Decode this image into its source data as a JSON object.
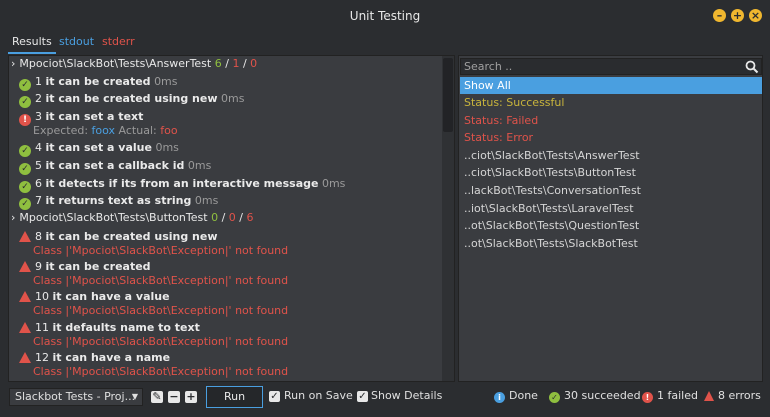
{
  "window": {
    "title": "Unit Testing"
  },
  "tabs": [
    {
      "label": "Results"
    },
    {
      "label": "stdout"
    },
    {
      "label": "stderr"
    }
  ],
  "suites": [
    {
      "name": "Mpociot\\SlackBot\\Tests\\AnswerTest",
      "passed": "6",
      "failed": "1",
      "errors": "0",
      "tests": [
        {
          "num": "1",
          "name": "it can be created",
          "time": "0ms",
          "status": "ok"
        },
        {
          "num": "2",
          "name": "it can be created using new",
          "time": "0ms",
          "status": "ok"
        },
        {
          "num": "3",
          "name": "it can set a text",
          "status": "fail",
          "expected_label": "Expected:",
          "expected": "foox",
          "actual_label": "Actual:",
          "actual": "foo"
        },
        {
          "num": "4",
          "name": "it can set a value",
          "time": "0ms",
          "status": "ok"
        },
        {
          "num": "5",
          "name": "it can set a callback id",
          "time": "0ms",
          "status": "ok"
        },
        {
          "num": "6",
          "name": "it detects if its from an interactive message",
          "time": "0ms",
          "status": "ok"
        },
        {
          "num": "7",
          "name": "it returns text as string",
          "time": "0ms",
          "status": "ok"
        }
      ]
    },
    {
      "name": "Mpociot\\SlackBot\\Tests\\ButtonTest",
      "passed": "0",
      "failed": "0",
      "errors": "6",
      "tests": [
        {
          "num": "8",
          "name": "it can be created using new",
          "status": "error",
          "message": "Class |'Mpociot\\SlackBot\\Exception|' not found"
        },
        {
          "num": "9",
          "name": "it can be created",
          "status": "error",
          "message": "Class |'Mpociot\\SlackBot\\Exception|' not found"
        },
        {
          "num": "10",
          "name": "it can have a value",
          "status": "error",
          "message": "Class |'Mpociot\\SlackBot\\Exception|' not found"
        },
        {
          "num": "11",
          "name": "it defaults name to text",
          "status": "error",
          "message": "Class |'Mpociot\\SlackBot\\Exception|' not found"
        },
        {
          "num": "12",
          "name": "it can have a name",
          "status": "error",
          "message": "Class |'Mpociot\\SlackBot\\Exception|' not found"
        }
      ]
    }
  ],
  "filter_panel": {
    "search_placeholder": "Search ..",
    "items": [
      {
        "label": "Show All",
        "selected": true
      },
      {
        "label": "Status: Successful",
        "color": "#c8b43c"
      },
      {
        "label": "Status: Failed",
        "color": "#e0534a"
      },
      {
        "label": "Status: Error",
        "color": "#e0534a"
      },
      {
        "label": "..ciot\\SlackBot\\Tests\\AnswerTest"
      },
      {
        "label": "..ciot\\SlackBot\\Tests\\ButtonTest"
      },
      {
        "label": "..lackBot\\Tests\\ConversationTest"
      },
      {
        "label": "..iot\\SlackBot\\Tests\\LaravelTest"
      },
      {
        "label": "..ot\\SlackBot\\Tests\\QuestionTest"
      },
      {
        "label": "..ot\\SlackBot\\Tests\\SlackBotTest"
      }
    ]
  },
  "toolbar": {
    "project": "Slackbot Tests - Proj...",
    "run_label": "Run",
    "run_on_save_label": "Run on Save",
    "show_details_label": "Show Details"
  },
  "status": {
    "done": "Done",
    "succeeded": "30 succeeded",
    "failed": "1 failed",
    "errors": "8 errors"
  },
  "colors": {
    "accent": "#4a9fe0",
    "success": "#8fbf3f",
    "failure": "#e0534a",
    "window_button": "#f0b72f"
  }
}
